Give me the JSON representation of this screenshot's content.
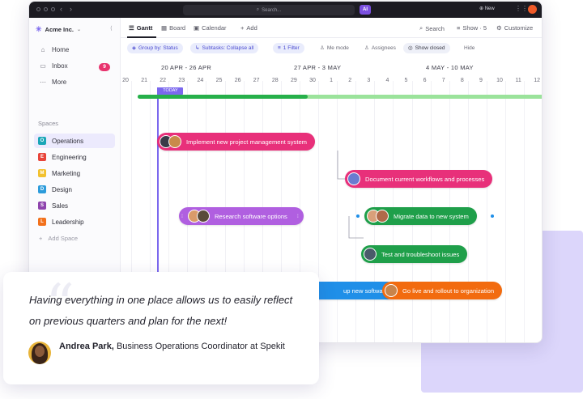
{
  "topbar": {
    "search_placeholder": "Search...",
    "ai_label": "AI",
    "new_label": "New"
  },
  "sidebar": {
    "workspace": "Acme Inc.",
    "nav": [
      {
        "label": "Home",
        "icon": "home-icon"
      },
      {
        "label": "Inbox",
        "icon": "inbox-icon",
        "badge": "9"
      },
      {
        "label": "More",
        "icon": "more-icon"
      }
    ],
    "spaces_label": "Spaces",
    "spaces": [
      {
        "letter": "O",
        "label": "Operations",
        "color": "#1aa6b7",
        "active": true
      },
      {
        "letter": "E",
        "label": "Engineering",
        "color": "#e8443a"
      },
      {
        "letter": "M",
        "label": "Marketing",
        "color": "#f2c12e"
      },
      {
        "letter": "D",
        "label": "Design",
        "color": "#2d9cdb"
      },
      {
        "letter": "S",
        "label": "Sales",
        "color": "#8e44ad"
      },
      {
        "letter": "L",
        "label": "Leadership",
        "color": "#f2711c"
      }
    ],
    "add_space": "Add Space"
  },
  "views": {
    "tabs": [
      "Gantt",
      "Board",
      "Calendar",
      "Add"
    ],
    "search": "Search",
    "show": "Show · 5",
    "customize": "Customize"
  },
  "filters": {
    "group_by": "Group by: Status",
    "subtasks": "Subtasks: Collapse all",
    "filter": "1 Filter",
    "me_mode": "Me mode",
    "assignees": "Assignees",
    "show_closed": "Show closed",
    "hide": "Hide"
  },
  "timeline": {
    "ranges": [
      "20 APR - 26 APR",
      "27 APR - 3 MAY",
      "4 MAY - 10 MAY"
    ],
    "days": [
      "20",
      "21",
      "22",
      "23",
      "24",
      "25",
      "26",
      "27",
      "28",
      "29",
      "30",
      "1",
      "2",
      "3",
      "4",
      "5",
      "6",
      "7",
      "8",
      "9",
      "10",
      "11",
      "12"
    ],
    "today_label": "TODAY",
    "progress_fraction": 0.42
  },
  "tasks": [
    {
      "label": "Implement new project management system",
      "color": "#e8307a"
    },
    {
      "label": "Document current workflows and processes",
      "color": "#e8307a"
    },
    {
      "label": "Research software options",
      "color": "#b05fe0"
    },
    {
      "label": "Migrate data to new system",
      "color": "#1f9f4a"
    },
    {
      "label": "Test and troubleshoot issues",
      "color": "#1f9f4a"
    },
    {
      "label": "up new software",
      "color": "#1f8fe8"
    },
    {
      "label": "Go live and rollout to organization",
      "color": "#f26b0f"
    }
  ],
  "testimonial": {
    "quote": "Having everything in one place allows us to easily reflect on previous quarters and plan for the next!",
    "author_name": "Andrea Park,",
    "author_role": "Business Operations Coordinator at Spekit"
  },
  "colors": {
    "accent": "#7b68ee",
    "progress_done": "#26b04a",
    "progress_todo": "#9be39b"
  }
}
